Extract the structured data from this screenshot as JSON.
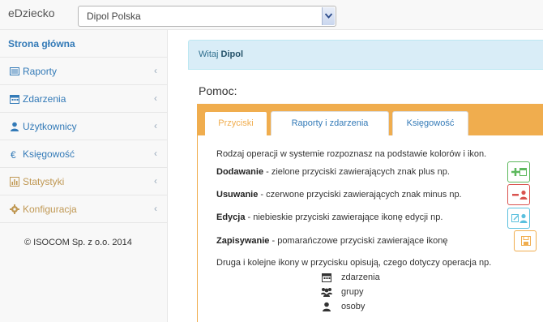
{
  "navbar": {
    "brand": "eDziecko",
    "company_select": "Dipol Polska"
  },
  "sidebar": {
    "home": "Strona główna",
    "items": [
      {
        "label": "Raporty",
        "icon": "list-icon"
      },
      {
        "label": "Zdarzenia",
        "icon": "calendar-icon"
      },
      {
        "label": "Użytkownicy",
        "icon": "user-icon"
      },
      {
        "label": "Księgowość",
        "icon": "euro-icon"
      },
      {
        "label": "Statystyki",
        "icon": "chart-icon"
      },
      {
        "label": "Konfiguracja",
        "icon": "gear-icon"
      }
    ],
    "copyright": "© ISOCOM Sp. z o.o. 2014"
  },
  "main": {
    "welcome_prefix": "Witaj",
    "welcome_user": "Dipol",
    "help_title": "Pomoc:",
    "tabs": [
      {
        "label": "Przyciski",
        "active": true
      },
      {
        "label": "Raporty i zdarzenia",
        "active": false
      },
      {
        "label": "Księgowość",
        "active": false
      }
    ],
    "intro": "Rodzaj operacji w systemie rozpoznasz na podstawie kolorów i ikon.",
    "rows": [
      {
        "title": "Dodawanie",
        "text": " - zielone przyciski zawierających znak plus np.",
        "color": "#5cb85c",
        "icon": "plus-calendar-icon"
      },
      {
        "title": "Usuwanie",
        "text": " - czerwone przyciski zawierających znak minus np.",
        "color": "#d9534f",
        "icon": "minus-user-icon"
      },
      {
        "title": "Edycja",
        "text": " - niebieskie przyciski zawierające ikonę edycji np.",
        "color": "#5bc0de",
        "icon": "edit-user-icon"
      },
      {
        "title": "Zapisywanie",
        "text": " - pomarańczowe przyciski zawierające ikonę",
        "color": "#f0ad4e",
        "icon": "save-icon"
      }
    ],
    "second_icons": "Druga i kolejne ikony w przycisku opisują, czego dotyczy operacja np.",
    "legend": [
      {
        "label": "zdarzenia",
        "icon": "calendar-icon"
      },
      {
        "label": "grupy",
        "icon": "group-icon"
      },
      {
        "label": "osoby",
        "icon": "user-icon"
      }
    ]
  }
}
